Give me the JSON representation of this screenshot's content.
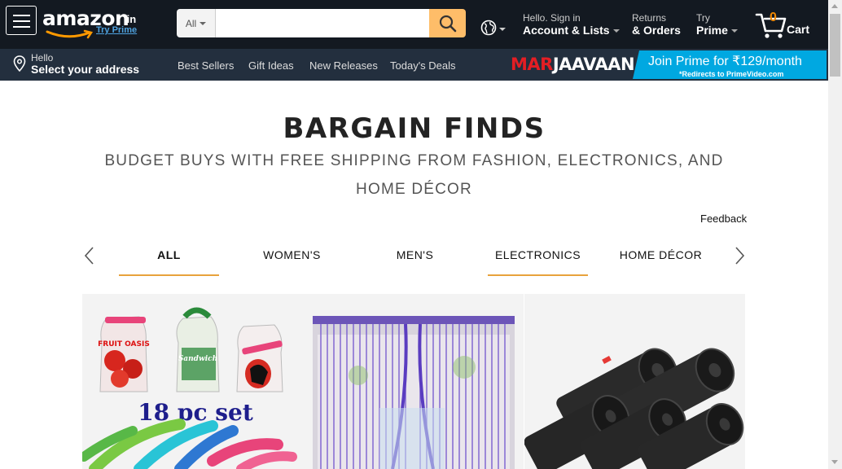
{
  "header": {
    "logo_text": "amazon",
    "logo_suffix": ".in",
    "try_prime": "Try Prime",
    "search_category": "All",
    "search_placeholder": "",
    "account_line1": "Hello. Sign in",
    "account_line2": "Account & Lists",
    "returns_line1": "Returns",
    "returns_line2": "& Orders",
    "prime_line1": "Try",
    "prime_line2": "Prime",
    "cart_count": "0",
    "cart_label": "Cart"
  },
  "subnav": {
    "address_line1": "Hello",
    "address_line2": "Select your address",
    "links": [
      "Best Sellers",
      "Gift Ideas",
      "New Releases",
      "Today's Deals"
    ]
  },
  "promo": {
    "marjaavaan_part1": "MAR",
    "marjaavaan_part2": "JAAVAAN",
    "prime_offer": "Join Prime for ₹129/month",
    "prime_note": "*Redirects to PrimeVideo.com"
  },
  "page": {
    "title": "BARGAIN FINDS",
    "subtitle": "BUDGET BUYS WITH FREE SHIPPING FROM FASHION, ELECTRONICS, AND HOME DÉCOR",
    "feedback": "Feedback"
  },
  "tabs": [
    {
      "label": "ALL",
      "selected": true
    },
    {
      "label": "WOMEN'S",
      "selected": false
    },
    {
      "label": "MEN'S",
      "selected": false
    },
    {
      "label": "ELECTRONICS",
      "selected": false
    },
    {
      "label": "HOME DÉCOR",
      "selected": false
    }
  ],
  "products": [
    {
      "image_text": "18 pc set",
      "fruit_label": "FRUIT OASIS",
      "sandwich_label": "Sandwich"
    },
    {
      "image": "purple string curtain"
    },
    {
      "image": "black garbage bag rolls"
    }
  ],
  "colors": {
    "nav_dark": "#131921",
    "nav_light": "#232f3e",
    "search_button": "#febd69",
    "cart_count": "#f08804",
    "prime_blue": "#00a8e1",
    "tab_underline": "#e8a23c"
  }
}
